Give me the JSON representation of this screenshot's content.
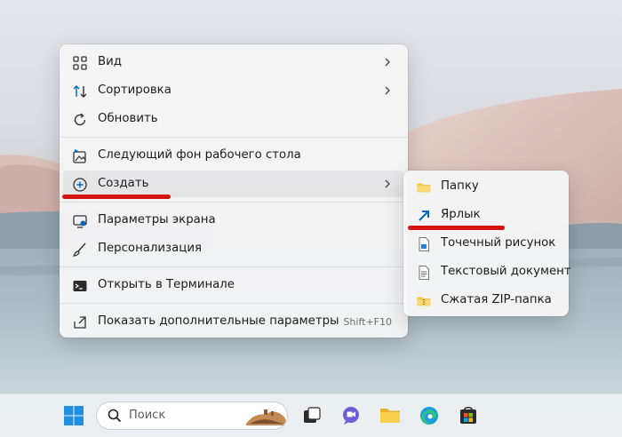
{
  "context_menu": {
    "items": [
      {
        "label": "Вид",
        "icon": "grid-icon",
        "has_submenu": true
      },
      {
        "label": "Сортировка",
        "icon": "sort-icon",
        "has_submenu": true
      },
      {
        "label": "Обновить",
        "icon": "refresh-icon",
        "has_submenu": false
      },
      {
        "label": "Следующий фон рабочего стола",
        "icon": "next-wallpaper-icon",
        "has_submenu": false
      },
      {
        "label": "Создать",
        "icon": "add-circle-icon",
        "has_submenu": true,
        "highlighted": true
      },
      {
        "label": "Параметры экрана",
        "icon": "display-settings-icon",
        "has_submenu": false
      },
      {
        "label": "Персонализация",
        "icon": "brush-icon",
        "has_submenu": false
      },
      {
        "label": "Открыть в Терминале",
        "icon": "terminal-icon",
        "has_submenu": false
      },
      {
        "label": "Показать дополнительные параметры",
        "icon": "more-options-icon",
        "shortcut": "Shift+F10"
      }
    ]
  },
  "submenu": {
    "items": [
      {
        "label": "Папку",
        "icon": "folder-icon"
      },
      {
        "label": "Ярлык",
        "icon": "shortcut-icon"
      },
      {
        "label": "Точечный рисунок",
        "icon": "bitmap-icon"
      },
      {
        "label": "Текстовый документ",
        "icon": "text-document-icon"
      },
      {
        "label": "Сжатая ZIP-папка",
        "icon": "zip-folder-icon"
      }
    ]
  },
  "taskbar": {
    "search_placeholder": "Поиск",
    "icons": [
      "windows-start-icon",
      "search-icon",
      "task-view-icon",
      "chat-icon",
      "file-explorer-icon",
      "edge-icon",
      "store-icon"
    ]
  },
  "colors": {
    "annotation_red": "#d41313",
    "accent_blue": "#0067c0"
  }
}
